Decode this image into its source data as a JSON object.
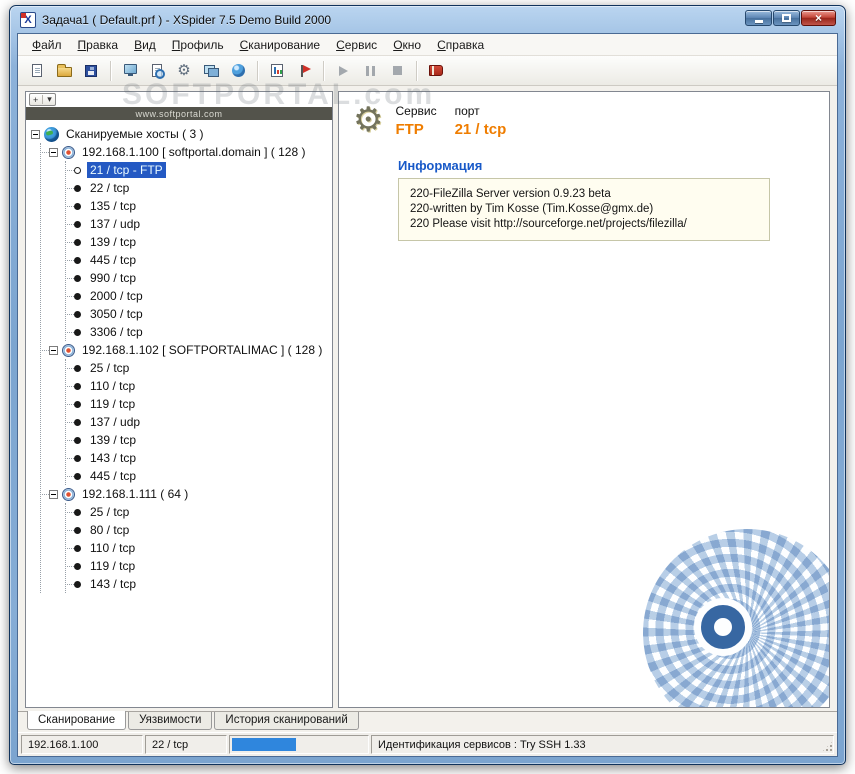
{
  "window": {
    "title": "Задача1 ( Default.prf ) - XSpider 7.5 Demo Build 2000"
  },
  "menu": {
    "items": [
      {
        "label": "Файл"
      },
      {
        "label": "Правка"
      },
      {
        "label": "Вид"
      },
      {
        "label": "Профиль"
      },
      {
        "label": "Сканирование"
      },
      {
        "label": "Сервис"
      },
      {
        "label": "Окно"
      },
      {
        "label": "Справка"
      }
    ]
  },
  "toolbar": {
    "groups": [
      {
        "buttons": [
          {
            "name": "new-task",
            "icon": "page"
          },
          {
            "name": "open-task",
            "icon": "folder"
          },
          {
            "name": "save-task",
            "icon": "floppy"
          }
        ]
      },
      {
        "buttons": [
          {
            "name": "add-host",
            "icon": "monitor"
          },
          {
            "name": "scan-profile",
            "icon": "page-magnifier"
          },
          {
            "name": "edit-profile",
            "icon": "gear-page"
          },
          {
            "name": "hosts-list",
            "icon": "monitors"
          },
          {
            "name": "network",
            "icon": "globe-small"
          }
        ]
      },
      {
        "buttons": [
          {
            "name": "report",
            "icon": "chart"
          },
          {
            "name": "checks",
            "icon": "flag"
          }
        ]
      },
      {
        "buttons": [
          {
            "name": "start-scan",
            "icon": "play",
            "disabled": true
          },
          {
            "name": "pause-scan",
            "icon": "pause",
            "disabled": true
          },
          {
            "name": "stop-scan",
            "icon": "stop",
            "disabled": true
          }
        ]
      },
      {
        "buttons": [
          {
            "name": "help",
            "icon": "book"
          }
        ]
      }
    ]
  },
  "watermarks": {
    "toolbar_text": "SOFTPORTAL.com",
    "tree_banner": "www.softportal.com"
  },
  "tree_toolbar": {
    "toggle_glyph": "+",
    "arrow_glyph": "▾"
  },
  "tree": {
    "root_label": "Сканируемые хосты ( 3 )",
    "hosts": [
      {
        "label": "192.168.1.100 [ softportal.domain ] ( 128 )",
        "selected_index": 0,
        "ports": [
          "21 / tcp - FTP",
          "22 / tcp",
          "135 / tcp",
          "137 / udp",
          "139 / tcp",
          "445 / tcp",
          "990 / tcp",
          "2000 / tcp",
          "3050 / tcp",
          "3306 / tcp"
        ]
      },
      {
        "label": "192.168.1.102 [ SOFTPORTALIMAC ] ( 128 )",
        "selected_index": -1,
        "ports": [
          "25 / tcp",
          "110 / tcp",
          "119 / tcp",
          "137 / udp",
          "139 / tcp",
          "143 / tcp",
          "445 / tcp"
        ]
      },
      {
        "label": "192.168.1.111 ( 64 )",
        "selected_index": -1,
        "ports": [
          "25 / tcp",
          "80 / tcp",
          "110 / tcp",
          "119 / tcp",
          "143 / tcp"
        ]
      }
    ]
  },
  "detail": {
    "service_label": "Сервис",
    "port_label": "порт",
    "service_value": "FTP",
    "port_value": "21 / tcp",
    "info_title": "Информация",
    "info_lines": [
      "220-FileZilla Server version 0.9.23 beta",
      "220-written by Tim Kosse (Tim.Kosse@gmx.de)",
      "220 Please visit http://sourceforge.net/projects/filezilla/"
    ],
    "accent_color": "#ef7d00",
    "title_color": "#1859c8"
  },
  "tabs": [
    {
      "label": "Сканирование",
      "active": true
    },
    {
      "label": "Уязвимости",
      "active": false
    },
    {
      "label": "История сканирований",
      "active": false
    }
  ],
  "statusbar": {
    "host": "192.168.1.100",
    "port": "22 / tcp",
    "progress_percent": 48,
    "status": "Идентификация сервисов : Try SSH 1.33"
  }
}
